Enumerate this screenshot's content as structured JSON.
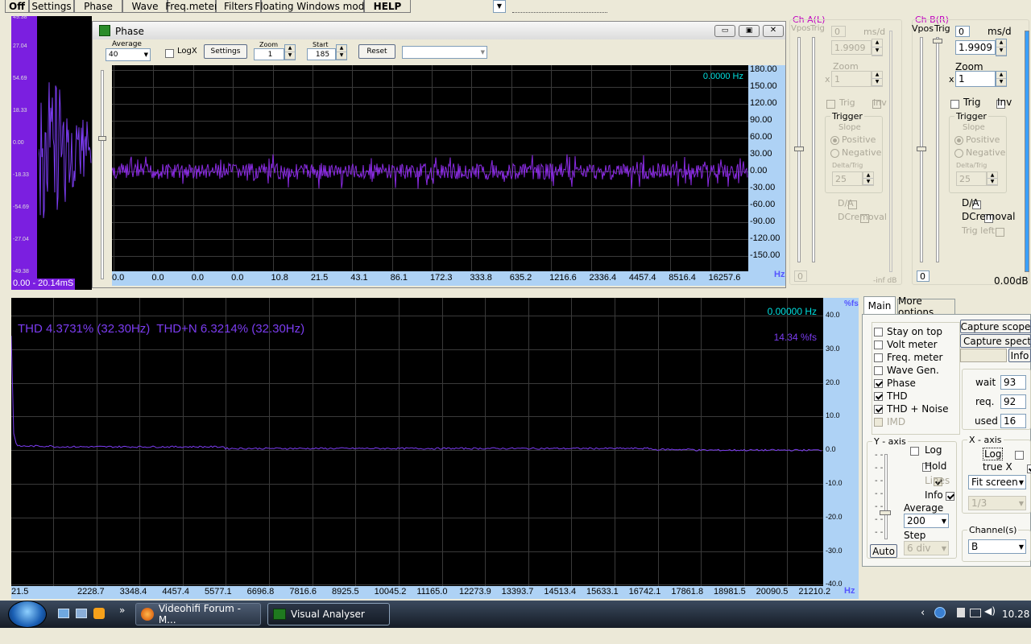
{
  "toolbar": {
    "items": [
      "Off",
      "Settings",
      "Phase",
      "Wave",
      "Freq.meter",
      "Filters",
      "Floating Windows mode",
      "HELP"
    ]
  },
  "left_scope": {
    "y_labels": [
      "27.04",
      "54.69",
      "18.33",
      "0.00",
      "-18.33",
      "-54.69",
      "-27.04",
      "-49.38"
    ],
    "top_label": "49.38",
    "bottom_label": "0.00 - 20.14mS"
  },
  "phase_window": {
    "title": "Phase",
    "average_label": "Average",
    "average_value": "40",
    "logx_label": "LogX",
    "settings_label": "Settings",
    "zoom_label": "Zoom",
    "zoom_value": "1",
    "start_label": "Start",
    "start_value": "185",
    "reset_label": "Reset",
    "freq_readout": "0.0000 Hz",
    "y_ticks": [
      "180.00",
      "150.00",
      "120.00",
      "90.00",
      "60.00",
      "30.00",
      "0.00",
      "-30.00",
      "-60.00",
      "-90.00",
      "-120.00",
      "-150.00"
    ],
    "x_ticks": [
      "0.0",
      "0.0",
      "0.0",
      "0.0",
      "10.8",
      "21.5",
      "43.1",
      "86.1",
      "172.3",
      "333.8",
      "635.2",
      "1216.6",
      "2336.4",
      "4457.4",
      "8516.4",
      "16257.6"
    ],
    "x_unit": "Hz"
  },
  "ch_a": {
    "title": "Ch A(L)",
    "vpos": "Vpos",
    "trig": "Trig",
    "ms_label": "ms/d",
    "zero": "0",
    "ms_value": "1.9909",
    "zoom_label": "Zoom",
    "zoom_x": "x",
    "zoom_value": "1",
    "trig_cb": "Trig",
    "inv_cb": "Inv",
    "trigger_group": "Trigger",
    "slope": "Slope",
    "positive": "Positive",
    "negative": "Negative",
    "delta_label": "Delta/Trig",
    "delta_value": "25",
    "da": "D/A",
    "dcremoval": "DCremoval",
    "bottom_zero": "0",
    "level": "-inf dB"
  },
  "ch_b": {
    "title": "Ch B(R)",
    "vpos": "Vpos",
    "trig": "Trig",
    "ms_label": "ms/d",
    "zero": "0",
    "ms_value": "1.9909",
    "zoom_label": "Zoom",
    "zoom_x": "x",
    "zoom_value": "1",
    "trig_cb": "Trig",
    "inv_cb": "Inv",
    "trigger_group": "Trigger",
    "slope": "Slope",
    "positive": "Positive",
    "negative": "Negative",
    "delta_label": "Delta/Trig",
    "delta_value": "25",
    "da": "D/A",
    "dcremoval": "DCremoval",
    "trig_left": "Trig left",
    "bottom_zero": "0",
    "level": "0.00dB"
  },
  "spectrum": {
    "thd_text": "THD 4.3731% (32.30Hz)  THD+N 6.3214% (32.30Hz)",
    "freq_readout": "0.00000 Hz",
    "fs_readout": "14.34 %fs",
    "y_unit": "%fs",
    "y_ticks": [
      "40.0",
      "30.0",
      "20.0",
      "10.0",
      "0.0",
      "-10.0",
      "-20.0",
      "-30.0",
      "-40.0"
    ],
    "x_ticks": [
      "21.5",
      "2228.7",
      "3348.4",
      "4457.4",
      "5577.1",
      "6696.8",
      "7816.6",
      "8925.5",
      "10045.2",
      "11165.0",
      "12273.9",
      "13393.7",
      "14513.4",
      "15633.1",
      "16742.1",
      "17861.8",
      "18981.5",
      "20090.5",
      "21210.2"
    ],
    "x_unit": "Hz"
  },
  "right_panel": {
    "tabs": [
      "Main",
      "More options"
    ],
    "checks": [
      {
        "label": "Stay on top",
        "checked": false
      },
      {
        "label": "Volt meter",
        "checked": false
      },
      {
        "label": "Freq. meter",
        "checked": false
      },
      {
        "label": "Wave Gen.",
        "checked": false
      },
      {
        "label": "Phase",
        "checked": true
      },
      {
        "label": "THD",
        "checked": true
      },
      {
        "label": "THD + Noise",
        "checked": true
      },
      {
        "label": "IMD",
        "checked": false,
        "disabled": true
      }
    ],
    "capture_scope": "Capture scope",
    "capture_spectrum": "Capture spectrum",
    "info_btn": "Info",
    "wait_label": "wait",
    "wait_value": "93",
    "req_label": "req.",
    "req_value": "92",
    "used_label": "used",
    "used_value": "16",
    "yaxis_title": "Y - axis",
    "y_log": "Log",
    "y_hold": "Hold",
    "y_lines": "Lines",
    "y_info": "Info",
    "average_label": "Average",
    "average_value": "200",
    "step_label": "Step",
    "step_value": "6 div",
    "auto_btn": "Auto",
    "xaxis_title": "X - axis",
    "x_log": "Log",
    "true_x": "true X",
    "fit_value": "Fit screen",
    "third_value": "1/3",
    "channel_title": "Channel(s)",
    "channel_value": "B"
  },
  "taskbar": {
    "tasks": [
      "Videohifi Forum - M...",
      "Visual Analyser"
    ],
    "clock": "10.28"
  },
  "chart_data": [
    {
      "type": "line",
      "title": "Phase",
      "series": [
        {
          "values": [
            0,
            0,
            0,
            0,
            0,
            0,
            0,
            0,
            0,
            0,
            0,
            0,
            0,
            0,
            0,
            0
          ]
        }
      ],
      "x": [
        "0.0",
        "0.0",
        "0.0",
        "0.0",
        "10.8",
        "21.5",
        "43.1",
        "86.1",
        "172.3",
        "333.8",
        "635.2",
        "1216.6",
        "2336.4",
        "4457.4",
        "8516.4",
        "16257.6"
      ],
      "ylim": [
        -180,
        180
      ],
      "xlabel": "Hz",
      "grid": true
    },
    {
      "type": "line",
      "title": "THD 4.3731% (32.30Hz)  THD+N 6.3214% (32.30Hz)",
      "series": [
        {
          "values": [
            30,
            1,
            1,
            1,
            1,
            0.5,
            0.5,
            0.5,
            0.5,
            0.5,
            0.5,
            0.5,
            0.5,
            0.5,
            0.5,
            0.2,
            0,
            0,
            0
          ]
        }
      ],
      "x": [
        "21.5",
        "2228.7",
        "3348.4",
        "4457.4",
        "5577.1",
        "6696.8",
        "7816.6",
        "8925.5",
        "10045.2",
        "11165.0",
        "12273.9",
        "13393.7",
        "14513.4",
        "15633.1",
        "16742.1",
        "17861.8",
        "18981.5",
        "20090.5",
        "21210.2"
      ],
      "ylim": [
        -40,
        40
      ],
      "xlabel": "Hz",
      "ylabel": "%fs",
      "grid": true
    }
  ]
}
